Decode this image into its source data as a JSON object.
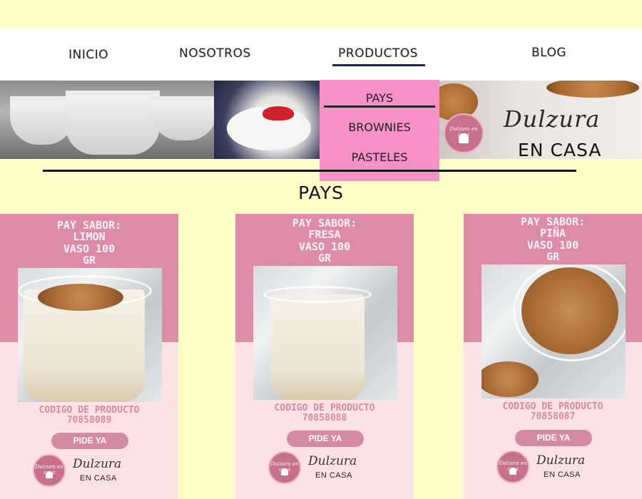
{
  "nav": {
    "items": [
      "INICIO",
      "NOSOTROS",
      "PRODUCTOS",
      "BLOG"
    ]
  },
  "dropdown": {
    "items": [
      "PAYS",
      "BROWNIES",
      "PASTELES"
    ]
  },
  "brand": {
    "script": "Dulzura",
    "sub": "EN CASA",
    "logo_text": "Dulzura en casa"
  },
  "section": {
    "title": "PAYS"
  },
  "cards": [
    {
      "title_lines": [
        "PAY SABOR:",
        "LIMON",
        "VASO 100",
        "GR"
      ],
      "code_label": "CODIGO DE PRODUCTO",
      "code": "70858089",
      "button": "PIDE YA"
    },
    {
      "title_lines": [
        "PAY SABOR:",
        "FRESA",
        "VASO 100",
        "GR"
      ],
      "code_label": "CODIGO DE PRODUCTO",
      "code": "70858088",
      "button": "PIDE YA"
    },
    {
      "title_lines": [
        "PAY SABOR:",
        "PIÑA",
        "VASO 100",
        "GR"
      ],
      "code_label": "CODIGO DE PRODUCTO",
      "code": "70858087",
      "button": "PIDE YA"
    }
  ],
  "colors": {
    "page_bg": "#fffdc8",
    "dropdown_bg": "#f691c8",
    "card_top": "#dc8ca4",
    "card_bottom": "#fde2e5",
    "button": "#d58aa3",
    "nav_active_underline": "#1a2a4a"
  },
  "icons": [
    "cupcake-logo-icon"
  ]
}
